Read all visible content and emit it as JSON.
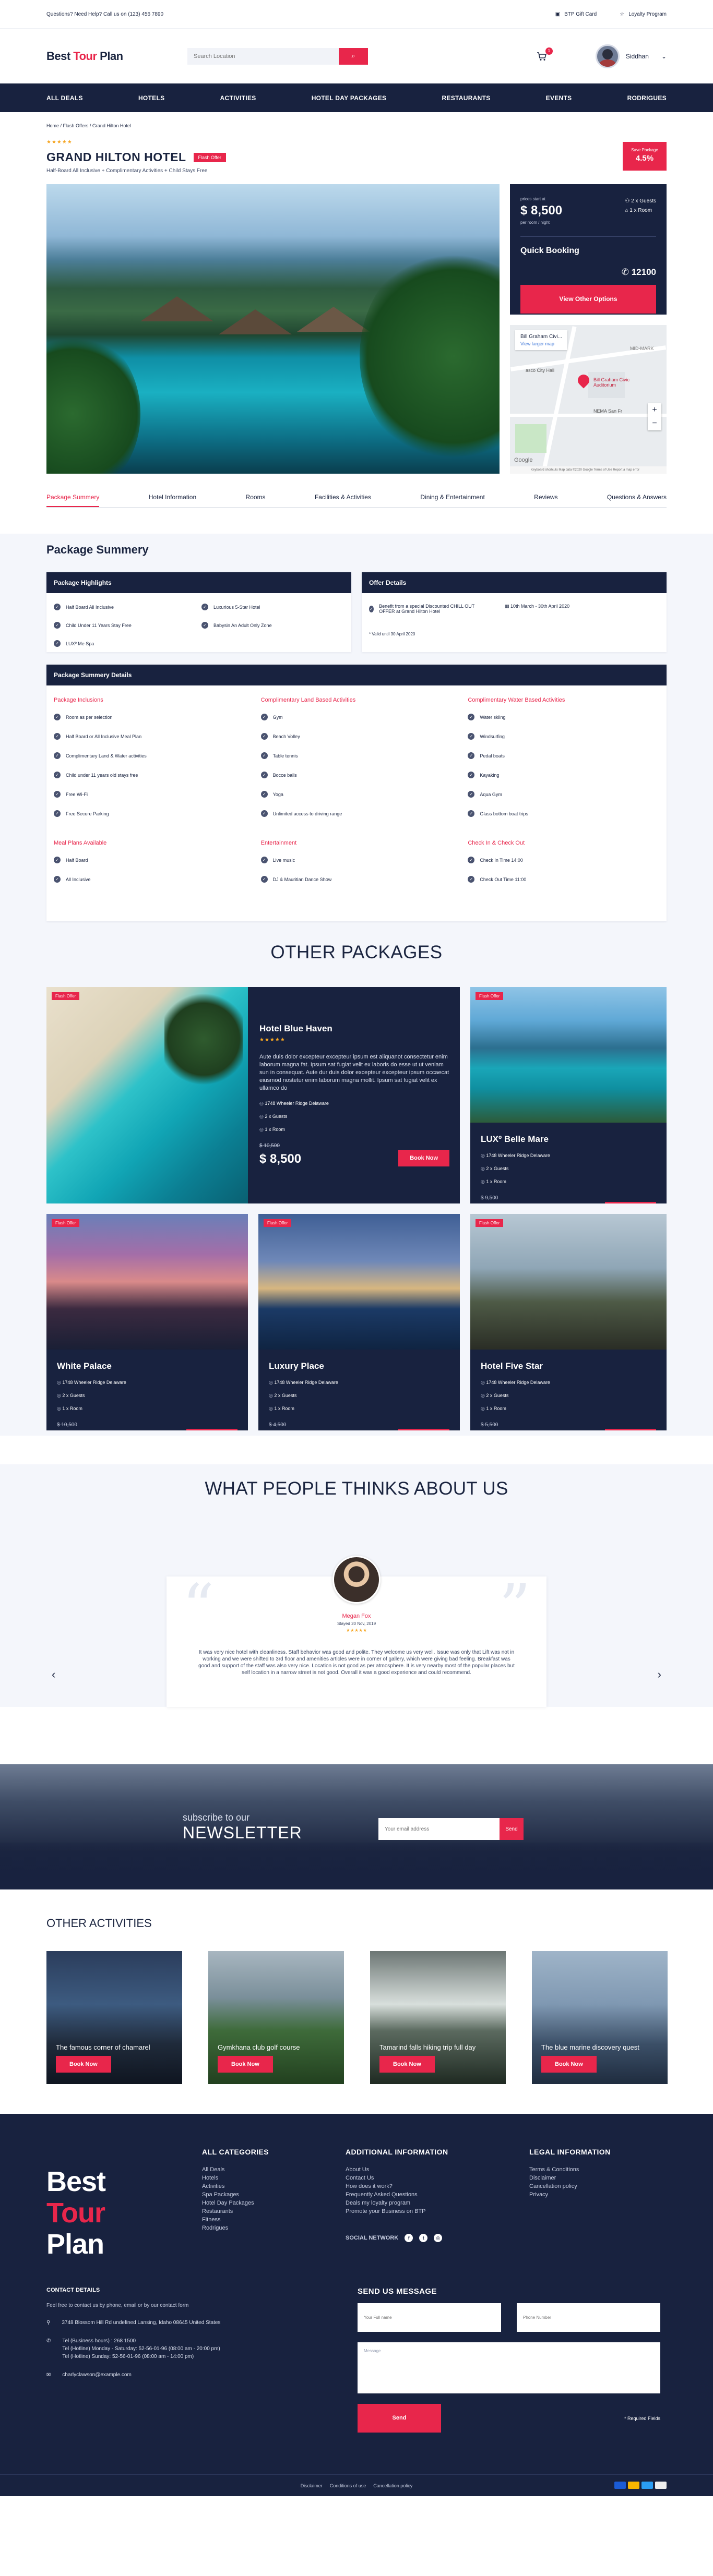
{
  "topbar": {
    "question": "Questions? Need Help? Call us on (123) 456 7890",
    "gift": "BTP Gift Card",
    "loyalty": "Loyalty Program"
  },
  "header": {
    "logo_a": "Best ",
    "logo_b": "Tour",
    "logo_c": " Plan",
    "search_placeholder": "Search Location",
    "cart_count": "1",
    "user_name": "Siddhan"
  },
  "nav": [
    "ALL DEALS",
    "HOTELS",
    "ACTIVITIES",
    "HOTEL DAY PACKAGES",
    "RESTAURANTS",
    "EVENTS",
    "RODRIGUES"
  ],
  "breadcrumb": "Home / Flash Offers / Grand Hilton Hotel",
  "hotel": {
    "stars": "★★★★★",
    "name": "GRAND HILTON HOTEL",
    "flash": "Flash Offer",
    "subtitle": "Half-Board All Inclusive + Complimentary Activities + Child Stays Free",
    "save_label": "Save Package",
    "save_value": "4.5%"
  },
  "price_card": {
    "from": "prices start at",
    "price": "$ 8,500",
    "per": "per room / night",
    "guests": "2 x Guests",
    "rooms": "1 x Room",
    "quick_booking": "Quick Booking",
    "code": "12100",
    "button": "View Other Options"
  },
  "map": {
    "name": "Bill Graham Civi...",
    "link": "View larger map",
    "labels": [
      "asco City Hall",
      "Bill Graham Civic Auditorium",
      "NEMA San Fr",
      "MID-MARK",
      "Google"
    ],
    "footer": "Keyboard shortcuts  Map data ©2020 Google  Terms of Use  Report a map error"
  },
  "tabs": [
    "Package Summery",
    "Hotel Information",
    "Rooms",
    "Facilities & Activities",
    "Dining & Entertainment",
    "Reviews",
    "Questions & Answers"
  ],
  "summary": {
    "title": "Package Summery",
    "highlights_title": "Package Highlights",
    "highlights": [
      "Half Board All Inclusive",
      "Luxurious 5-Star Hotel",
      "Child Under 11 Years Stay Free",
      "Babysin An Adult Only Zone",
      "LUXº Me Spa"
    ],
    "offer_title": "Offer Details",
    "offer_text": "Benefit from a special Discounted CHILL OUT OFFER at Grand Hilton Hotel",
    "offer_dates": "10th March - 30th April 2020",
    "offer_note": "* Valid until 30 April 2020",
    "details_title": "Package Summery Details",
    "columns": [
      {
        "groups": [
          {
            "title": "Package Inclusions",
            "items": [
              "Room as per selection",
              "Half Board or All Inclusive Meal Plan",
              "Complimentary Land & Water activities",
              "Child under 11 years old stays free",
              "Free Wi-Fi",
              "Free Secure Parking"
            ]
          },
          {
            "title": "Meal Plans Available",
            "items": [
              "Half Board",
              "All Inclusive"
            ]
          }
        ]
      },
      {
        "groups": [
          {
            "title": "Complimentary Land Based Activities",
            "items": [
              "Gym",
              "Beach Volley",
              "Table tennis",
              "Bocce balls",
              "Yoga",
              "Unlimited access to driving range"
            ]
          },
          {
            "title": "Entertainment",
            "items": [
              "Live music",
              "DJ & Mauritian Dance Show"
            ]
          }
        ]
      },
      {
        "groups": [
          {
            "title": "Complimentary Water Based Activities",
            "items": [
              "Water skiing",
              "Windsurfing",
              "Pedal boats",
              "Kayaking",
              "Aqua Gym",
              "Glass bottom boat trips"
            ]
          },
          {
            "title": "Check In & Check Out",
            "items": [
              "Check In Time 14:00",
              "Check Out Time 11:00"
            ]
          }
        ]
      }
    ]
  },
  "other_packages": {
    "title": "OTHER PACKAGES",
    "flash": "Flash Offer",
    "address": "1748 Wheeler Ridge Delaware",
    "guests": "2 x Guests",
    "room": "1 x Room",
    "book": "Book Now",
    "featured": {
      "name": "Hotel Blue Haven",
      "stars": "★★★★★",
      "desc": "Aute duis dolor excepteur excepteur ipsum est aliquanot consectetur enim laborum magna fat. Ipsum sat fugiat velit ex laboris do esse ut ut veniam sun in consequat. Aute dur duis dolor excepteur excepteur ipsum occaecat eiusmod nostetur enim laborum magna mollit. Ipsum sat fugiat velit ex ullamco do",
      "old": "$ 10,500",
      "price": "$ 8,500"
    },
    "items": [
      {
        "name": "LUXº Belle Mare",
        "old": "$ 9,500",
        "price": "$ 3,000"
      },
      {
        "name": "White Palace",
        "old": "$ 10,500",
        "price": "$ 9,500"
      },
      {
        "name": "Luxury Place",
        "old": "$ 4,500",
        "price": "$ 2,500"
      },
      {
        "name": "Hotel Five Star",
        "old": "$ 5,500",
        "price": "$ 3,500"
      }
    ]
  },
  "testimonials": {
    "title": "WHAT PEOPLE THINKS ABOUT US",
    "name": "Megan Fox",
    "date": "Stayed 20 Nov, 2019",
    "stars": "★★★★★",
    "text": "It was very nice hotel with cleanliness. Staff behavior was good and polite. They welcome us very well. Issue was only that Lift was not in working and we were shifted to 3rd floor and amenities articles were in corner of gallery, which were giving bad feeling. Breakfast was good and support of the staff was also very nice. Location is not good as per atmosphere. It is very nearby most of the popular places but self location in a narrow street is not good. Overall it was a good experience and could recommend."
  },
  "newsletter": {
    "small": "subscribe to our",
    "big": "NEWSLETTER",
    "placeholder": "Your email address",
    "button": "Send"
  },
  "activities": {
    "title": "OTHER ACTIVITIES",
    "button": "Book Now",
    "items": [
      "The famous corner of chamarel",
      "Gymkhana club golf course",
      "Tamarind falls hiking trip full day",
      "The blue marine discovery quest"
    ]
  },
  "footer": {
    "logo": [
      "Best",
      "Tour",
      "Plan"
    ],
    "categories_title": "ALL CATEGORIES",
    "categories": [
      "All Deals",
      "Hotels",
      "Activities",
      "Spa Packages",
      "Hotel Day Packages",
      "Restaurants",
      "Fitness",
      "Rodrigues"
    ],
    "info_title": "ADDITIONAL INFORMATION",
    "info": [
      "About Us",
      "Contact Us",
      "How does it work?",
      "Frequently Asked Questions",
      "Deals my loyalty program",
      "Promote your Business on BTP"
    ],
    "social_title": "SOCIAL NETWORK",
    "legal_title": "LEGAL INFORMATION",
    "legal": [
      "Terms & Conditions",
      "Disclaimer",
      "Cancellation policy",
      "Privacy"
    ],
    "contact_title": "CONTACT DETAILS",
    "contact_text": "Feel free to contact us by phone, email or by our contact form",
    "address": "3748 Blossom Hill Rd undefined Lansing, Idaho 08645 United States",
    "phone1": "Tel (Business hours) : 268 1500",
    "phone2": "Tel (Hotline) Monday - Saturday: 52-56-01-96 (08:00 am - 20:00 pm)",
    "phone3": "Tel (Hotline) Sunday: 52-56-01-96 (08:00 am - 14:00 pm)",
    "email": "charlyclawson@example.com",
    "message_title": "SEND US MESSAGE",
    "name_ph": "Your Full name",
    "phone_ph": "Phone Number",
    "message_ph": "Message",
    "send": "Send",
    "required": "* Required Fields",
    "bottom": [
      "Disclaimer",
      "Conditions of use",
      "Cancellation policy"
    ]
  },
  "colors": {
    "brand_red": "#e8264b",
    "navy": "#18223f"
  }
}
